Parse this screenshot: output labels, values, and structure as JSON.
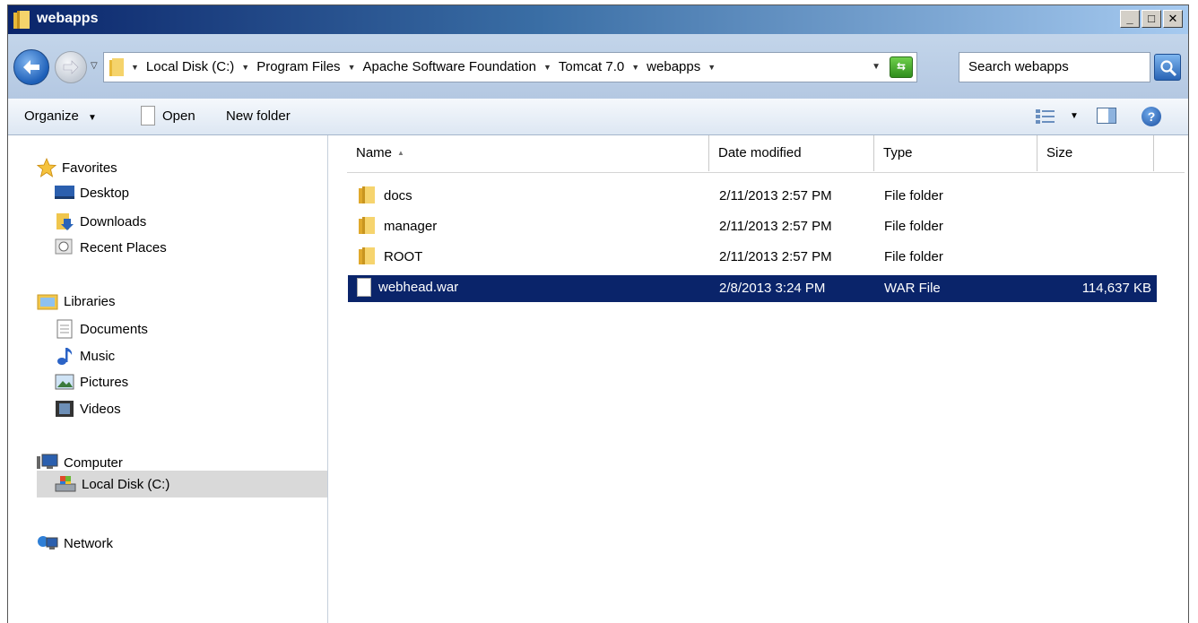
{
  "window": {
    "title": "webapps",
    "controls": {
      "minimize": "_",
      "maximize": "□",
      "close": "✕"
    }
  },
  "address": {
    "crumbs": [
      "Local Disk (C:)",
      "Program Files",
      "Apache Software Foundation",
      "Tomcat 7.0",
      "webapps"
    ],
    "search_placeholder": "Search webapps"
  },
  "toolbar": {
    "organize_label": "Organize",
    "open_label": "Open",
    "new_folder_label": "New folder"
  },
  "nav": {
    "favorites": "Favorites",
    "desktop": "Desktop",
    "downloads": "Downloads",
    "recent_places": "Recent Places",
    "libraries": "Libraries",
    "documents": "Documents",
    "music": "Music",
    "pictures": "Pictures",
    "videos": "Videos",
    "computer": "Computer",
    "local_disk": "Local Disk (C:)",
    "network": "Network"
  },
  "columns": {
    "name": "Name",
    "date": "Date modified",
    "type": "Type",
    "size": "Size"
  },
  "files": [
    {
      "name": "docs",
      "date": "2/11/2013 2:57 PM",
      "type": "File folder",
      "size": "",
      "kind": "folder"
    },
    {
      "name": "manager",
      "date": "2/11/2013 2:57 PM",
      "type": "File folder",
      "size": "",
      "kind": "folder"
    },
    {
      "name": "ROOT",
      "date": "2/11/2013 2:57 PM",
      "type": "File folder",
      "size": "",
      "kind": "folder"
    },
    {
      "name": "webhead.war",
      "date": "2/8/2013 3:24 PM",
      "type": "WAR File",
      "size": "114,637 KB",
      "kind": "file",
      "selected": true
    }
  ],
  "colors": {
    "title_gradient_start": "#0a246a",
    "selection": "#0a246a",
    "address_bg": "#c3d5ea"
  }
}
